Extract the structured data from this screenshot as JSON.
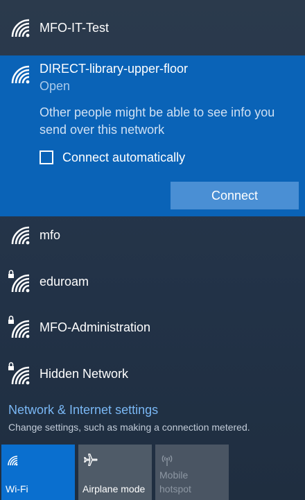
{
  "colors": {
    "selected_bg": "#0a63b7",
    "connect_button_bg": "#4a8fd4",
    "link": "#7ab8f5",
    "tile_active": "#0a6fcf",
    "tile_inactive": "#4f5b68"
  },
  "networks": [
    {
      "name": "MFO-IT-Test",
      "icon": "wifi-signal-icon",
      "secured": false
    },
    {
      "name": "mfo",
      "icon": "wifi-signal-icon",
      "secured": false
    },
    {
      "name": "eduroam",
      "icon": "wifi-secured-icon",
      "secured": true
    },
    {
      "name": "MFO-Administration",
      "icon": "wifi-secured-icon",
      "secured": true
    },
    {
      "name": "Hidden Network",
      "icon": "wifi-secured-icon",
      "secured": true
    }
  ],
  "selected_network": {
    "name": "DIRECT-library-upper-floor",
    "status": "Open",
    "warning": "Other people might be able to see info you send over this network",
    "auto_connect_label": "Connect automatically",
    "auto_connect_checked": false,
    "connect_label": "Connect"
  },
  "settings": {
    "link_label": "Network & Internet settings",
    "description": "Change settings, such as making a connection metered."
  },
  "quick_actions": [
    {
      "label": "Wi-Fi",
      "icon": "wifi-icon",
      "active": true
    },
    {
      "label": "Airplane mode",
      "icon": "airplane-icon",
      "active": false
    },
    {
      "label": "Mobile hotspot",
      "icon": "hotspot-icon",
      "active": false,
      "disabled": true
    }
  ]
}
